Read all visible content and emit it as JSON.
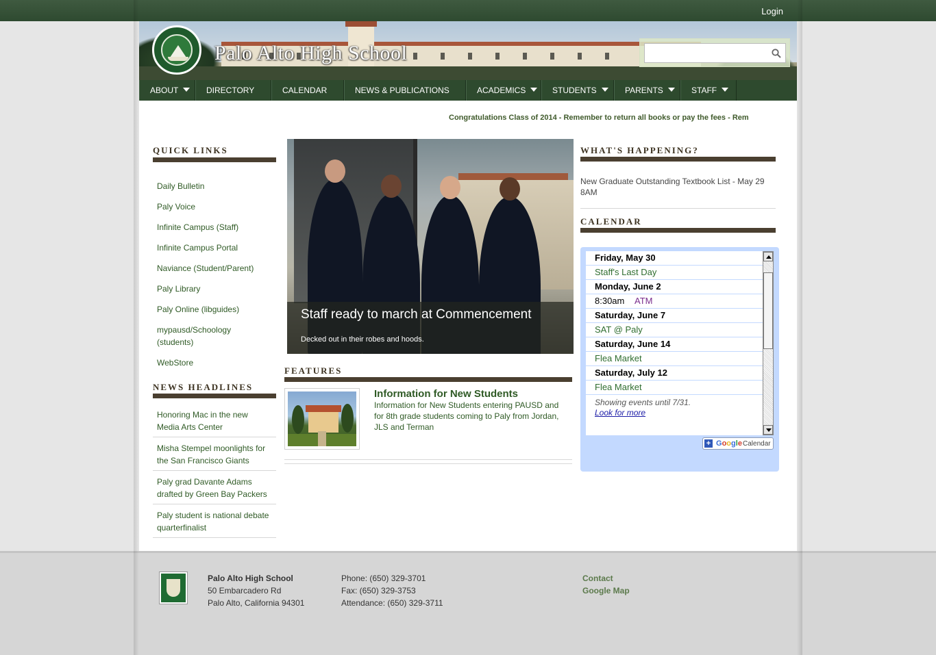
{
  "header": {
    "login_label": "Login",
    "site_title": "Palo Alto High School",
    "search_placeholder": "",
    "search_value": ""
  },
  "nav": {
    "items": [
      {
        "label": "ABOUT",
        "dropdown": true
      },
      {
        "label": "DIRECTORY",
        "dropdown": false
      },
      {
        "label": "CALENDAR",
        "dropdown": false
      },
      {
        "label": "NEWS & PUBLICATIONS",
        "dropdown": false
      },
      {
        "label": "ACADEMICS",
        "dropdown": true
      },
      {
        "label": "STUDENTS",
        "dropdown": true
      },
      {
        "label": "PARENTS",
        "dropdown": true
      },
      {
        "label": "STAFF",
        "dropdown": true
      }
    ]
  },
  "ticker": {
    "text": "Congratulations Class of 2014 - Remember to return all books or pay the fees - Rem"
  },
  "quick_links": {
    "title": "QUICK LINKS",
    "items": [
      "Daily Bulletin",
      "Paly Voice",
      "Infinite Campus (Staff)",
      "Infinite Campus Portal",
      "Naviance (Student/Parent)",
      "Paly Library",
      "Paly Online (libguides)",
      "mypausd/Schoology (students)",
      "WebStore"
    ]
  },
  "news_headlines": {
    "title": "NEWS HEADLINES",
    "items": [
      "Honoring Mac in the new Media Arts Center",
      "Misha Stempel moonlights for the San Francisco Giants",
      "Paly grad Davante Adams drafted by Green Bay Packers",
      "Paly student is national debate quarterfinalist"
    ]
  },
  "slideshow": {
    "caption_title": "Staff ready to march at Commencement",
    "caption_sub": "Decked out in their robes and hoods."
  },
  "features": {
    "title": "FEATURES",
    "item_title": "Information for New Students",
    "item_desc": "Information for New Students entering PAUSD and for 8th grade students coming to Paly from Jordan, JLS and Terman"
  },
  "whats_happening": {
    "title": "WHAT'S HAPPENING?",
    "item": "New Graduate Outstanding Textbook List - May 29 8AM"
  },
  "calendar": {
    "title": "CALENDAR",
    "rows": [
      {
        "type": "date",
        "text": "Friday, May 30"
      },
      {
        "type": "event",
        "time": "",
        "text": "Staff's Last Day",
        "color": "#2f6d2f"
      },
      {
        "type": "date",
        "text": "Monday, June 2"
      },
      {
        "type": "event",
        "time": "8:30am",
        "text": "ATM",
        "color": "#7a2d8c"
      },
      {
        "type": "date",
        "text": "Saturday, June 7"
      },
      {
        "type": "event",
        "time": "",
        "text": "SAT @ Paly",
        "color": "#2f6d2f"
      },
      {
        "type": "date",
        "text": "Saturday, June 14"
      },
      {
        "type": "event",
        "time": "",
        "text": "Flea Market",
        "color": "#2f6d2f"
      },
      {
        "type": "date",
        "text": "Saturday, July 12"
      },
      {
        "type": "event",
        "time": "",
        "text": "Flea Market",
        "color": "#2f6d2f"
      }
    ],
    "showing_until": "Showing events until 7/31.",
    "look_more": "Look for more",
    "google_label": "Google",
    "google_suffix": "Calendar"
  },
  "footer": {
    "school_name": "Palo Alto High School",
    "address1": "50 Embarcadero Rd",
    "address2": "Palo Alto, California 94301",
    "phone": "Phone: (650) 329-3701",
    "fax": "Fax: (650) 329-3753",
    "attendance": "Attendance: (650) 329-3711",
    "contact_label": "Contact",
    "map_label": "Google Map"
  },
  "colors": {
    "nav_bg": "#2e4a2e",
    "link_green": "#2f5a25",
    "section_bar": "#4a3f30",
    "calendar_bg": "#c3d9ff"
  },
  "icons": {
    "search": "magnifier-icon",
    "dropdown": "caret-down-icon",
    "scroll_up": "arrow-up-icon",
    "scroll_down": "arrow-down-icon"
  }
}
